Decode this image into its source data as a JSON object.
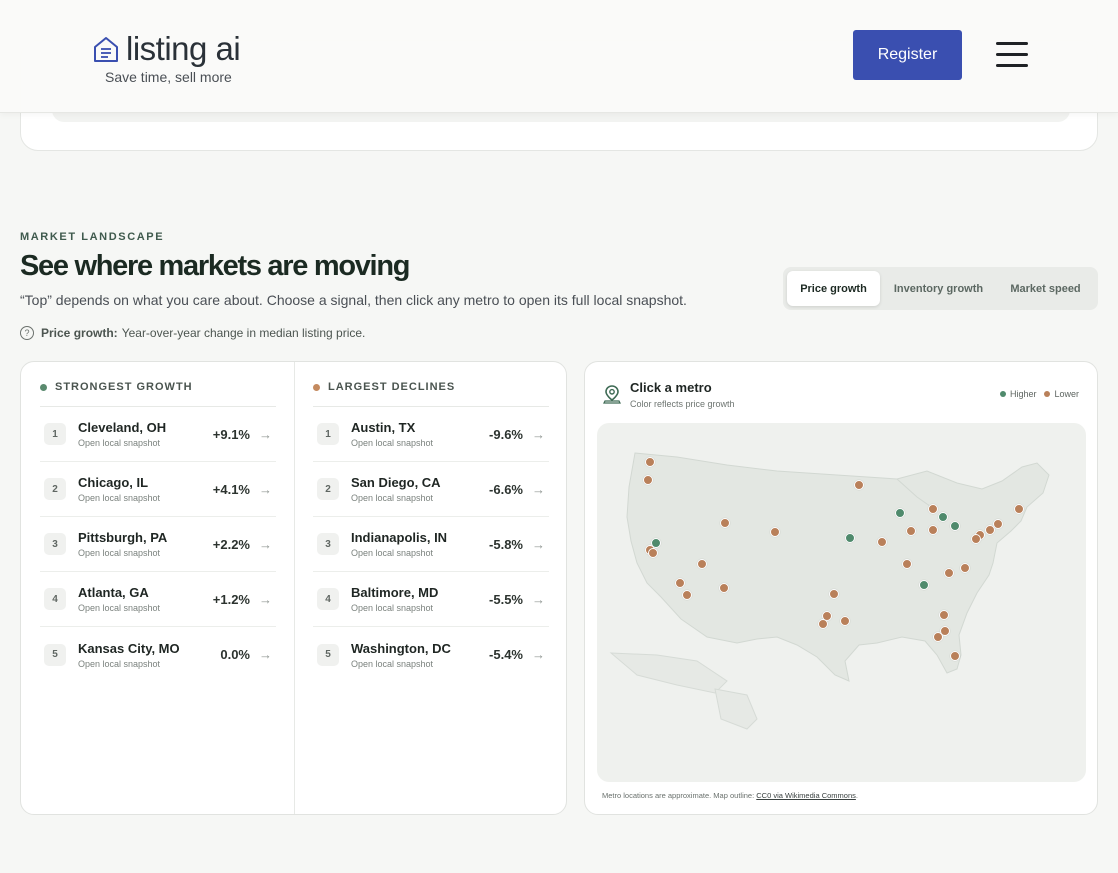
{
  "header": {
    "logo_text": "listing ai",
    "tagline": "Save time, sell more",
    "register_label": "Register"
  },
  "section": {
    "eyebrow": "MARKET LANDSCAPE",
    "title": "See where markets are moving",
    "subtitle": "“Top” depends on what you care about. Choose a signal, then click any metro to open its full local snapshot.",
    "hint_label": "Price growth:",
    "hint_text": "Year-over-year change in median listing price."
  },
  "tabs": [
    {
      "label": "Price growth",
      "active": true
    },
    {
      "label": "Inventory growth",
      "active": false
    },
    {
      "label": "Market speed",
      "active": false
    }
  ],
  "growth": {
    "heading": "STRONGEST GROWTH",
    "rows": [
      {
        "rank": "1",
        "city": "Cleveland, OH",
        "sub": "Open local snapshot",
        "value": "+9.1%"
      },
      {
        "rank": "2",
        "city": "Chicago, IL",
        "sub": "Open local snapshot",
        "value": "+4.1%"
      },
      {
        "rank": "3",
        "city": "Pittsburgh, PA",
        "sub": "Open local snapshot",
        "value": "+2.2%"
      },
      {
        "rank": "4",
        "city": "Atlanta, GA",
        "sub": "Open local snapshot",
        "value": "+1.2%"
      },
      {
        "rank": "5",
        "city": "Kansas City, MO",
        "sub": "Open local snapshot",
        "value": "0.0%"
      }
    ]
  },
  "declines": {
    "heading": "LARGEST DECLINES",
    "rows": [
      {
        "rank": "1",
        "city": "Austin, TX",
        "sub": "Open local snapshot",
        "value": "-9.6%"
      },
      {
        "rank": "2",
        "city": "San Diego, CA",
        "sub": "Open local snapshot",
        "value": "-6.6%"
      },
      {
        "rank": "3",
        "city": "Indianapolis, IN",
        "sub": "Open local snapshot",
        "value": "-5.8%"
      },
      {
        "rank": "4",
        "city": "Baltimore, MD",
        "sub": "Open local snapshot",
        "value": "-5.5%"
      },
      {
        "rank": "5",
        "city": "Washington, DC",
        "sub": "Open local snapshot",
        "value": "-5.4%"
      }
    ]
  },
  "map": {
    "title": "Click a metro",
    "subtitle": "Color reflects price growth",
    "legend_higher": "Higher",
    "legend_lower": "Lower",
    "footer_text": "Metro locations are approximate. Map outline:",
    "footer_link": "CC0 via Wikimedia Commons",
    "footer_end": ".",
    "colors": {
      "higher": "#4f8a6c",
      "lower": "#b9805a"
    }
  },
  "colors": {
    "accent": "#3a4fb0",
    "brand_green": "#3f5a4d"
  }
}
